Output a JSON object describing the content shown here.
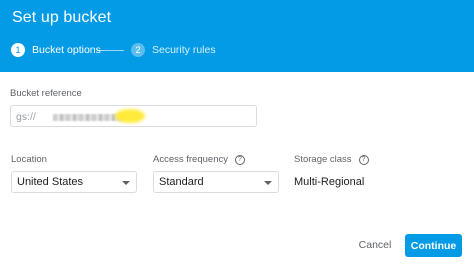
{
  "dialog": {
    "title": "Set up bucket",
    "accent_color": "#039be5"
  },
  "steps": [
    {
      "number": "1",
      "label": "Bucket options",
      "state": "active"
    },
    {
      "number": "2",
      "label": "Security rules",
      "state": "inactive"
    }
  ],
  "bucket_reference": {
    "label": "Bucket reference",
    "prefix": "gs://"
  },
  "location": {
    "label": "Location",
    "value": "United States"
  },
  "access_frequency": {
    "label": "Access frequency",
    "help_icon": "help-icon",
    "value": "Standard"
  },
  "storage_class": {
    "label": "Storage class",
    "help_icon": "help-icon",
    "value": "Multi-Regional"
  },
  "actions": {
    "cancel_label": "Cancel",
    "continue_label": "Continue"
  }
}
